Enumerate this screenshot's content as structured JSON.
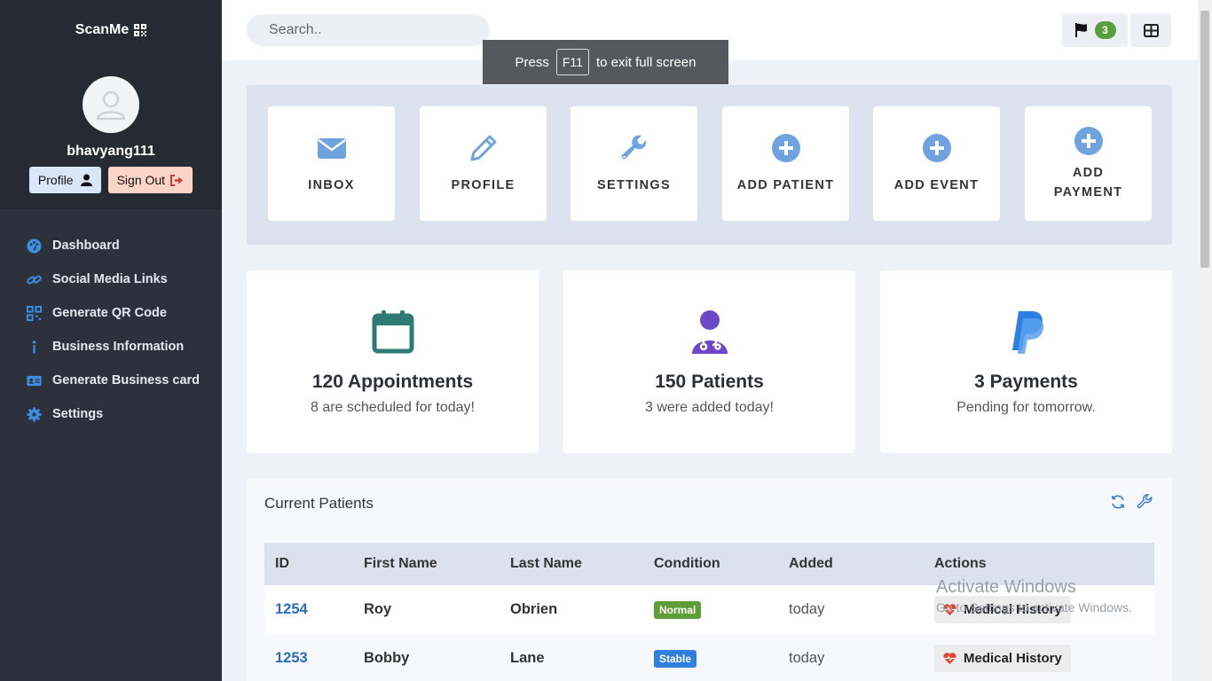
{
  "sidebar": {
    "brand": "ScanMe",
    "username": "bhavyang111",
    "profile_label": "Profile",
    "signout_label": "Sign Out",
    "items": [
      {
        "label": "Dashboard",
        "icon": "palette-icon"
      },
      {
        "label": "Social Media Links",
        "icon": "link-icon"
      },
      {
        "label": "Generate QR Code",
        "icon": "qrcode-icon"
      },
      {
        "label": "Business Information",
        "icon": "info-icon"
      },
      {
        "label": "Generate Business card",
        "icon": "id-card-icon"
      },
      {
        "label": "Settings",
        "icon": "gear-icon"
      }
    ]
  },
  "topbar": {
    "search_placeholder": "Search..",
    "flag_count": "3"
  },
  "fullscreen_toast": {
    "pre": "Press",
    "key": "F11",
    "post": "to exit full screen"
  },
  "quick_actions": [
    {
      "label": "INBOX",
      "icon": "envelope-icon"
    },
    {
      "label": "PROFILE",
      "icon": "pencil-icon"
    },
    {
      "label": "SETTINGS",
      "icon": "wrench-icon"
    },
    {
      "label": "ADD PATIENT",
      "icon": "plus-circle-icon"
    },
    {
      "label": "ADD EVENT",
      "icon": "plus-circle-icon"
    },
    {
      "label": "ADD PAYMENT",
      "icon": "plus-circle-icon"
    }
  ],
  "stats": [
    {
      "title": "120 Appointments",
      "sub": "8 are scheduled for today!",
      "icon": "calendar-icon"
    },
    {
      "title": "150 Patients",
      "sub": "3 were added today!",
      "icon": "doctor-icon"
    },
    {
      "title": "3 Payments",
      "sub": "Pending for tomorrow.",
      "icon": "paypal-icon"
    }
  ],
  "patients": {
    "title": "Current Patients",
    "columns": [
      "ID",
      "First Name",
      "Last Name",
      "Condition",
      "Added",
      "Actions"
    ],
    "rows": [
      {
        "id": "1254",
        "first": "Roy",
        "last": "Obrien",
        "condition": "Normal",
        "added": "today",
        "action": "Medical History"
      },
      {
        "id": "1253",
        "first": "Bobby",
        "last": "Lane",
        "condition": "Stable",
        "added": "today",
        "action": "Medical History"
      }
    ]
  },
  "watermark": {
    "line1": "Activate Windows",
    "line2": "Go to Settings to activate Windows."
  },
  "colors": {
    "sidebar": "#2c313b",
    "accent_blue": "#2a6cc0",
    "icon_blue": "#6fa3e0",
    "badge_green": "#5a9e3d"
  }
}
